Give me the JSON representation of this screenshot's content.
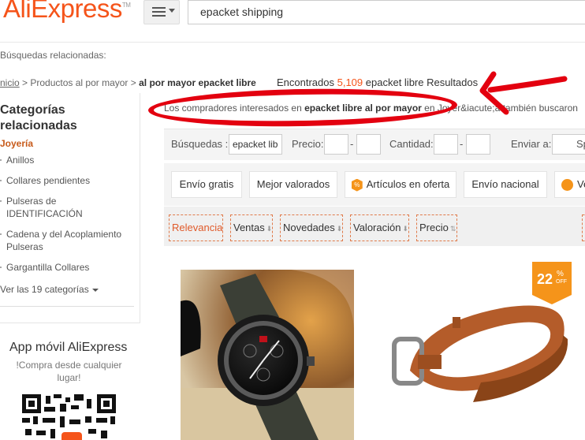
{
  "header": {
    "logo": "AliExpress",
    "logo_tm": "TM",
    "search_value": "epacket shipping"
  },
  "related_searches_label": "Búsquedas relacionadas:",
  "breadcrumb": {
    "home": "nicio",
    "sep1": " > ",
    "level1": "Productos al por mayor",
    "sep2": " > ",
    "current": "al por mayor epacket libre"
  },
  "results": {
    "prefix": "Encontrados ",
    "count": "5,109",
    "suffix": " epacket libre Resultados"
  },
  "interested": {
    "prefix": "Los compradores interesados en ",
    "term": "epacket libre al por mayor",
    "suffix": " en Joyer&iacute;a también buscaron"
  },
  "sidebar": {
    "title_line1": "Categorías",
    "title_line2": "relacionadas",
    "group": "Joyería",
    "items": [
      {
        "label": "Anillos"
      },
      {
        "label": "Collares pendientes"
      },
      {
        "label": "Pulseras de IDENTIFICACIÓN"
      },
      {
        "label": "Cadena y del Acoplamiento Pulseras"
      },
      {
        "label": "Gargantilla Collares"
      }
    ],
    "see_all": "Ver las 19 categorías"
  },
  "app_promo": {
    "title": "App móvil AliExpress",
    "subtitle": "!Compra desde cualquier lugar!"
  },
  "filters": {
    "search_label": "Búsquedas :",
    "search_value": "epacket lib",
    "price_label": "Precio:",
    "price_sep": "-",
    "qty_label": "Cantidad:",
    "qty_sep": "-",
    "ship_label": "Enviar a:",
    "ship_value": "Sp"
  },
  "tags": {
    "free_shipping": "Envío gratis",
    "top_rated": "Mejor valorados",
    "sale_icon": "%",
    "on_sale": "Artículos en oferta",
    "national": "Envío nacional",
    "more": "Ve"
  },
  "sort": {
    "relevance": "Relevancia",
    "sales": "Ventas",
    "new": "Novedades",
    "rating": "Valoración",
    "price": "Precio"
  },
  "products": {
    "badge_pct": "22",
    "badge_sym": "%",
    "badge_off": "OFF"
  },
  "colors": {
    "brand": "#f5541a",
    "annotation_red": "#e3000f",
    "badge": "#f5941a"
  }
}
